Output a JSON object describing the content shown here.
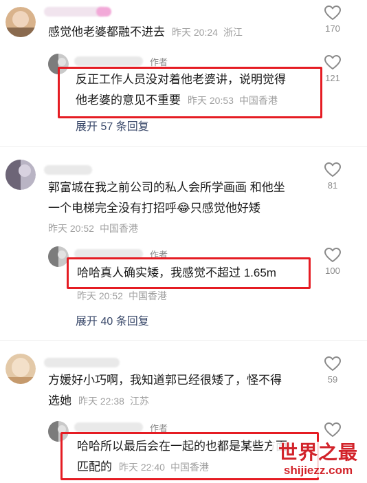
{
  "comments": [
    {
      "text_lines": [
        "感觉他老婆都融不进去"
      ],
      "time": "昨天 20:24",
      "location": "浙江",
      "likes": "170",
      "reply": {
        "author_tag": "作者",
        "text_lines": [
          "反正工作人员没对着他老婆讲，说明觉得",
          "他老婆的意见不重要"
        ],
        "time": "昨天 20:53",
        "location": "中国香港",
        "likes": "121"
      },
      "expand_label": "展开 57 条回复"
    },
    {
      "text_lines": [
        "郭富城在我之前公司的私人会所学画画 和他坐",
        "一个电梯完全没有打招呼😂只感觉他好矮"
      ],
      "time": "昨天 20:52",
      "location": "中国香港",
      "likes": "81",
      "reply": {
        "author_tag": "作者",
        "text_lines": [
          "哈哈真人确实矮，我感觉不超过 1.65m"
        ],
        "time": "昨天 20:52",
        "location": "中国香港",
        "likes": "100"
      },
      "expand_label": "展开 40 条回复"
    },
    {
      "text_lines": [
        "方媛好小巧啊，我知道郭已经很矮了，怪不得",
        "选她"
      ],
      "time": "昨天 22:38",
      "location": "江苏",
      "likes": "59",
      "reply": {
        "author_tag": "作者",
        "text_lines": [
          "哈哈所以最后会在一起的也都是某些方面",
          "匹配的"
        ],
        "time": "昨天 22:40",
        "location": "中国香港",
        "likes": ""
      }
    }
  ],
  "watermark": {
    "title": "世界之最",
    "url": "shijiezz.com"
  },
  "colors": {
    "highlight_box": "#e51c23",
    "watermark_red": "#d2232a",
    "link_blue": "#3b4a6b"
  }
}
